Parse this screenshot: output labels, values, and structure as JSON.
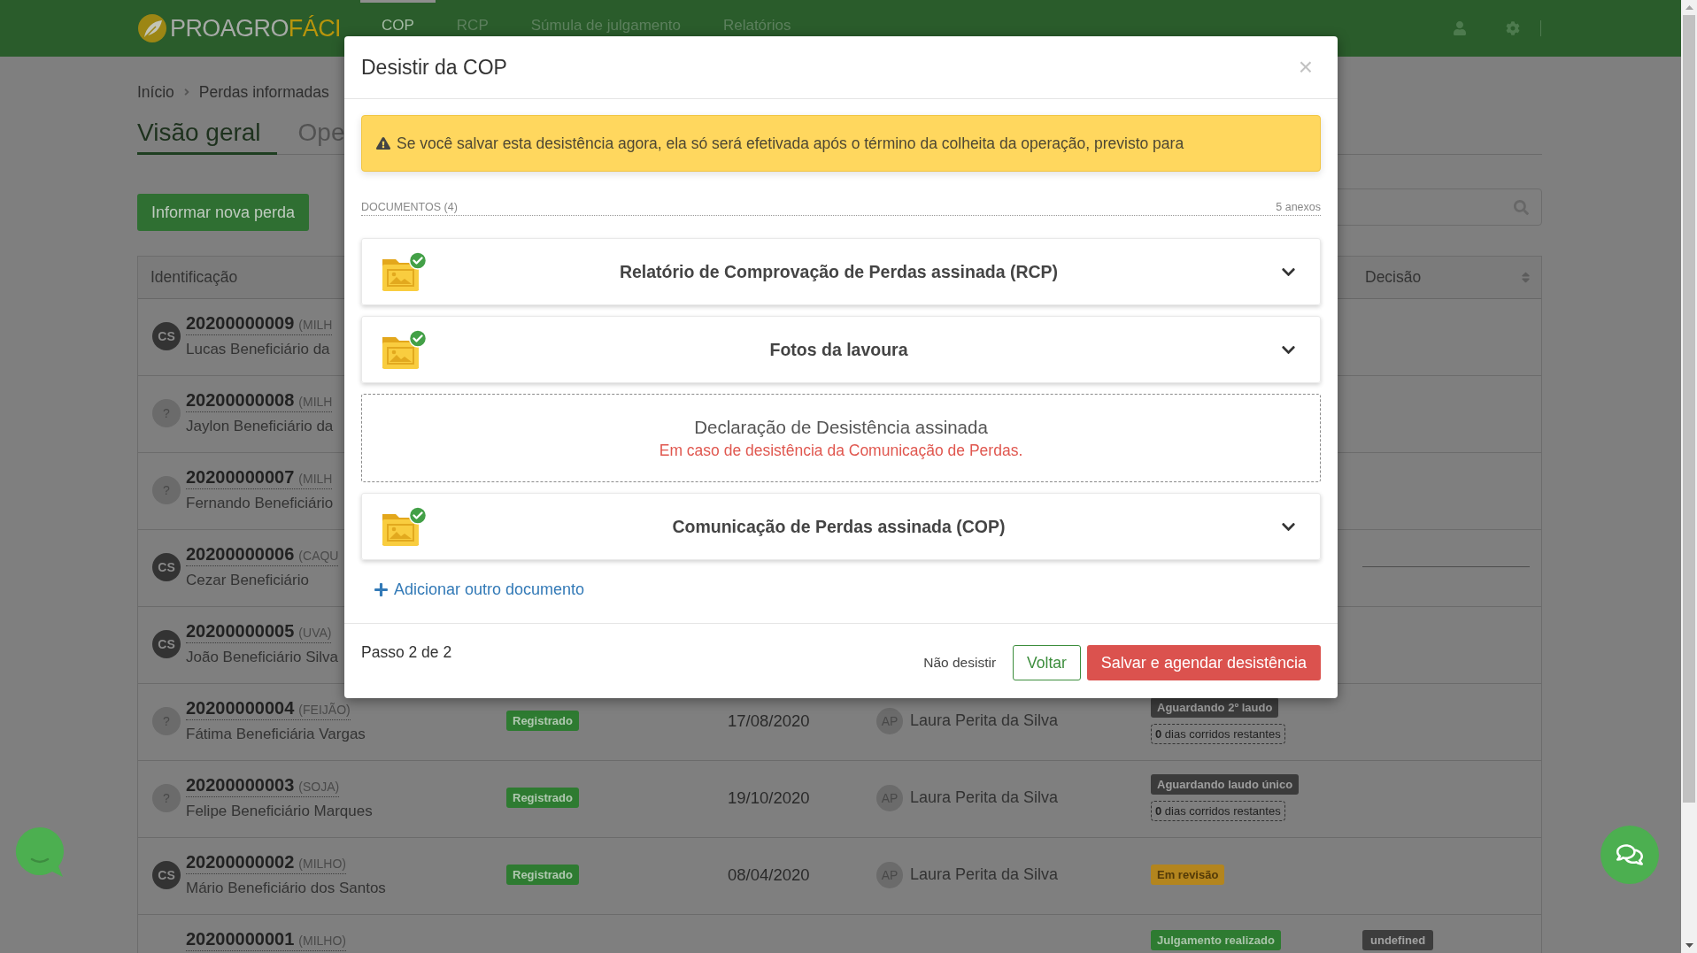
{
  "navbar": {
    "logo": {
      "part_1": "PROAGRO",
      "part_2": "FÁCI"
    },
    "items": [
      {
        "label": "COP",
        "selected": true
      },
      {
        "label": "RCP",
        "selected": false
      },
      {
        "label": "Súmula de julgamento",
        "selected": false
      },
      {
        "label": "Relatórios",
        "selected": false
      }
    ]
  },
  "breadcrumb": {
    "link": "Início",
    "current": "Perdas informadas"
  },
  "tabs": [
    {
      "label": "Visão geral",
      "selected": true
    },
    {
      "label": "Ope",
      "selected": false
    }
  ],
  "new_loss_button": "Informar nova perda",
  "table": {
    "columns": [
      {
        "label": "Identificação"
      },
      {
        "label": "Decisão",
        "sortable": true
      }
    ],
    "rows": [
      {
        "avatar": {
          "kind": "initials",
          "text": "CS"
        },
        "id": "20200000009",
        "crop": "(MILH",
        "name": "Lucas Beneficiário da"
      },
      {
        "avatar": {
          "kind": "unknown",
          "text": "?"
        },
        "id": "20200000008",
        "crop": "(MILH",
        "name": "Jaylon Beneficiário da"
      },
      {
        "avatar": {
          "kind": "unknown",
          "text": "?"
        },
        "id": "20200000007",
        "crop": "(MILH",
        "name": "Fernando Beneficiário"
      },
      {
        "avatar": {
          "kind": "initials",
          "text": "CS"
        },
        "id": "20200000006",
        "crop": "(CAQU",
        "name": "Cezar Beneficiário",
        "decision_line": true
      },
      {
        "avatar": {
          "kind": "initials",
          "text": "CS"
        },
        "id": "20200000005",
        "crop": "(UVA)",
        "name": "João Beneficiário Silva"
      },
      {
        "avatar": {
          "kind": "unknown",
          "text": "?"
        },
        "id": "20200000004",
        "crop": "(FEIJÃO)",
        "name": "Fátima Beneficiária Vargas",
        "status": "Registrado",
        "date": "17/08/2020",
        "analyst": {
          "initials": "AP",
          "name": "Laura Perita da Silva"
        },
        "stage": [
          {
            "kind": "waiting",
            "text": "Aguardando 2º laudo"
          }
        ],
        "countdown": "**0** dias corridos restantes"
      },
      {
        "avatar": {
          "kind": "unknown",
          "text": "?"
        },
        "id": "20200000003",
        "crop": "(SOJA)",
        "name": "Felipe Beneficiário Marques",
        "status": "Registrado",
        "date": "19/10/2020",
        "analyst": {
          "initials": "AP",
          "name": "Laura Perita da Silva"
        },
        "stage": [
          {
            "kind": "waiting",
            "text": "Aguardando laudo único"
          }
        ],
        "countdown": "**0** dias corridos restantes"
      },
      {
        "avatar": {
          "kind": "initials",
          "text": "CS"
        },
        "id": "20200000002",
        "crop": "(MILHO)",
        "name": "Mário Beneficiário dos Santos",
        "status": "Registrado",
        "date": "08/04/2020",
        "analyst": {
          "initials": "AP",
          "name": "Laura Perita da Silva"
        },
        "stage": [
          {
            "kind": "review",
            "text": "Em revisão"
          }
        ]
      },
      {
        "id": "20200000001",
        "crop": "(MILHO)",
        "stage": [
          {
            "kind": "done",
            "text": "Julgamento realizado"
          }
        ],
        "decision": "undefined"
      }
    ]
  },
  "modal": {
    "title": "Desistir da COP",
    "close": "×",
    "alert": "Se você salvar esta desistência agora, ela só será efetivada após o término da colheita da operação, previsto para",
    "documents": {
      "label": "DOCUMENTOS (4)",
      "count": "5 anexos",
      "items": [
        {
          "kind": "file",
          "title": "Relatório de Comprovação de Perdas assinada (RCP)",
          "expanded": false
        },
        {
          "kind": "file",
          "title": "Fotos da lavoura",
          "expanded": false
        },
        {
          "kind": "pending",
          "title": "Declaração de Desistência assinada",
          "hint": "Em caso de desistência da Comunicação de Perdas."
        },
        {
          "kind": "file",
          "title": "Comunicação de Perdas assinada (COP)",
          "expanded": false
        }
      ]
    },
    "add_link": "Adicionar outro documento",
    "step": "Passo 2 de 2",
    "buttons": [
      {
        "kind": "link",
        "label": "Não desistir"
      },
      {
        "kind": "outline",
        "label": "Voltar"
      },
      {
        "kind": "danger",
        "label": "Salvar e agendar desistência"
      }
    ]
  }
}
